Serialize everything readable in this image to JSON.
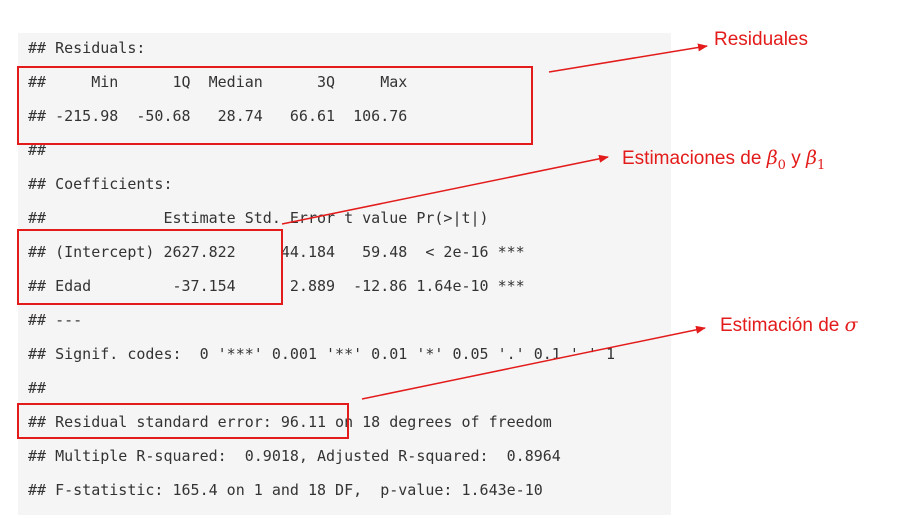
{
  "code_lines": [
    "## Residuals:",
    "##     Min      1Q  Median      3Q     Max",
    "## -215.98  -50.68   28.74   66.61  106.76",
    "##",
    "## Coefficients:",
    "##             Estimate Std. Error t value Pr(>|t|)",
    "## (Intercept) 2627.822     44.184   59.48  < 2e-16 ***",
    "## Edad         -37.154      2.889  -12.86 1.64e-10 ***",
    "## ---",
    "## Signif. codes:  0 '***' 0.001 '**' 0.01 '*' 0.05 '.' 0.1 ' ' 1",
    "##",
    "## Residual standard error: 96.11 on 18 degrees of freedom",
    "## Multiple R-squared:  0.9018, Adjusted R-squared:  0.8964",
    "## F-statistic: 165.4 on 1 and 18 DF,  p-value: 1.643e-10"
  ],
  "annotations": {
    "residuales": {
      "text": "Residuales"
    },
    "estimaciones_beta": {
      "text": "Estimaciones de",
      "beta": "β",
      "sub0": "0",
      "y": "y",
      "sub1": "1"
    },
    "estimacion_sigma": {
      "text": "Estimación de",
      "sigma": "σ"
    }
  },
  "colors": {
    "annotation": "#e31b1b",
    "panel_bg": "#f5f5f5",
    "code_text": "#333333"
  }
}
